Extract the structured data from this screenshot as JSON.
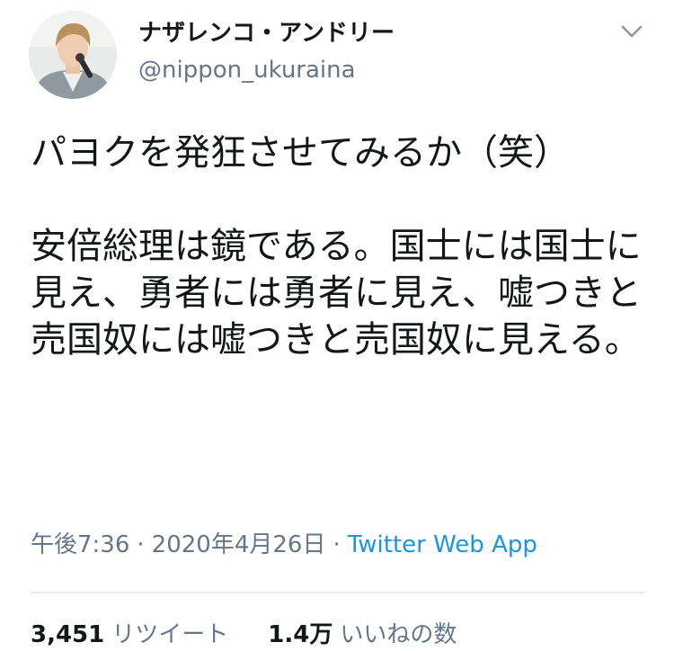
{
  "author": {
    "display_name": "ナザレンコ・アンドリー",
    "handle": "@nippon_ukuraina",
    "avatar_icon": "profile-photo"
  },
  "menu": {
    "caret_icon": "chevron-down-icon"
  },
  "tweet": {
    "text": "パヨクを発狂させてみるか（笑）\n\n安倍総理は鏡である。国士には国士に見え、勇者には勇者に見え、嘘つきと売国奴には嘘つきと売国奴に見える。"
  },
  "meta": {
    "time": "午後7:36",
    "separator": "·",
    "date": "2020年4月26日",
    "source": "Twitter Web App"
  },
  "stats": {
    "retweets_count": "3,451",
    "retweets_label": "リツイート",
    "likes_count": "1.4万",
    "likes_label": "いいねの数"
  },
  "colors": {
    "text_primary": "#14171a",
    "text_secondary": "#657786",
    "link": "#1b95e0",
    "divider": "#e6ecf0"
  }
}
